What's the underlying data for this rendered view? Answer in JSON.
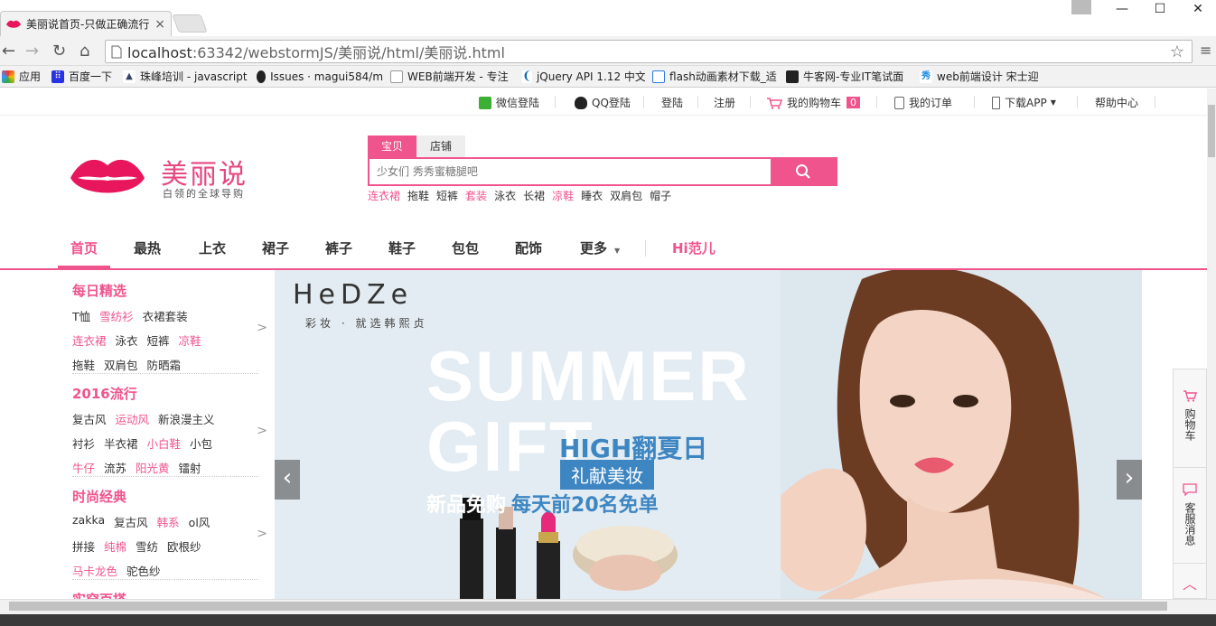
{
  "browser": {
    "tab_title": "美丽说首页-只做正确流行",
    "url_host": "localhost",
    "url_rest": ":63342/webstormJS/美丽说/html/美丽说.html",
    "bookmarks": [
      {
        "label": "应用",
        "icon": "apps-grid-icon",
        "color": "#e84"
      },
      {
        "label": "百度一下",
        "icon": "baidu-paw-icon",
        "color": "#2932e1"
      },
      {
        "label": "珠峰培训 - javascript",
        "icon": "mountain-icon",
        "color": "#346"
      },
      {
        "label": "Issues · magui584/m",
        "icon": "github-icon",
        "color": "#222"
      },
      {
        "label": "WEB前端开发 - 专注",
        "icon": "page-icon",
        "color": "#999"
      },
      {
        "label": "jQuery API 1.12 中文",
        "icon": "jquery-icon",
        "color": "#0769ad"
      },
      {
        "label": "flash动画素材下载_适",
        "icon": "page-icon",
        "color": "#2a7ae2"
      },
      {
        "label": "牛客网-专业IT笔试面",
        "icon": "nowcoder-icon",
        "color": "#222"
      },
      {
        "label": "web前端设计 宋士迎",
        "icon": "xiu-icon",
        "color": "#1a8ce6"
      }
    ]
  },
  "topbar": {
    "wechat_login": "微信登陆",
    "qq_login": "QQ登陆",
    "login": "登陆",
    "register": "注册",
    "cart": "我的购物车",
    "cart_count": "0",
    "orders": "我的订单",
    "download_app": "下载APP",
    "help": "帮助中心"
  },
  "logo": {
    "title": "美丽说",
    "subtitle": "白领的全球导购"
  },
  "search": {
    "tab_items": "宝贝",
    "tab_shops": "店铺",
    "placeholder": "少女们 秀秀蜜糖腿吧",
    "hot": [
      {
        "label": "连衣裙",
        "pink": true
      },
      {
        "label": "拖鞋",
        "pink": false
      },
      {
        "label": "短裤",
        "pink": false
      },
      {
        "label": "套装",
        "pink": true
      },
      {
        "label": "泳衣",
        "pink": false
      },
      {
        "label": "长裙",
        "pink": false
      },
      {
        "label": "凉鞋",
        "pink": true
      },
      {
        "label": "睡衣",
        "pink": false
      },
      {
        "label": "双肩包",
        "pink": false
      },
      {
        "label": "帽子",
        "pink": false
      }
    ]
  },
  "nav": {
    "home": "首页",
    "hot": "最热",
    "tops": "上衣",
    "skirts": "裙子",
    "pants": "裤子",
    "shoes": "鞋子",
    "bags": "包包",
    "accessories": "配饰",
    "more": "更多",
    "hi": "Hi范儿"
  },
  "categories": [
    {
      "title": "每日精选",
      "rows": [
        [
          {
            "t": "T恤",
            "p": false
          },
          {
            "t": "雪纺衫",
            "p": true
          },
          {
            "t": "衣裙套装",
            "p": false
          }
        ],
        [
          {
            "t": "连衣裙",
            "p": true
          },
          {
            "t": "泳衣",
            "p": false
          },
          {
            "t": "短裤",
            "p": false
          },
          {
            "t": "凉鞋",
            "p": true
          }
        ],
        [
          {
            "t": "拖鞋",
            "p": false
          },
          {
            "t": "双肩包",
            "p": false
          },
          {
            "t": "防晒霜",
            "p": false
          }
        ]
      ]
    },
    {
      "title": "2016流行",
      "rows": [
        [
          {
            "t": "复古风",
            "p": false
          },
          {
            "t": "运动风",
            "p": true
          },
          {
            "t": "新浪漫主义",
            "p": false
          }
        ],
        [
          {
            "t": "衬衫",
            "p": false
          },
          {
            "t": "半衣裙",
            "p": false
          },
          {
            "t": "小白鞋",
            "p": true
          },
          {
            "t": "小包",
            "p": false
          }
        ],
        [
          {
            "t": "牛仔",
            "p": true
          },
          {
            "t": "流苏",
            "p": false
          },
          {
            "t": "阳光黄",
            "p": true
          },
          {
            "t": "镭射",
            "p": false
          }
        ]
      ]
    },
    {
      "title": "时尚经典",
      "rows": [
        [
          {
            "t": "zakka",
            "p": false
          },
          {
            "t": "复古风",
            "p": false
          },
          {
            "t": "韩系",
            "p": true
          },
          {
            "t": "ol风",
            "p": false
          }
        ],
        [
          {
            "t": "拼接",
            "p": false
          },
          {
            "t": "纯棉",
            "p": true
          },
          {
            "t": "雪纺",
            "p": false
          },
          {
            "t": "欧根纱",
            "p": false
          }
        ],
        [
          {
            "t": "马卡龙色",
            "p": true
          },
          {
            "t": "驼色纱",
            "p": false
          }
        ]
      ]
    },
    {
      "title": "实穿百搭",
      "rows": []
    }
  ],
  "banner": {
    "brand": "HeDZe",
    "brand_sub": "彩妆 · 就选韩熙贞",
    "summer": "SUMMER",
    "gift": "GIFT",
    "high": "HIGH翻夏日",
    "tag": "礼献美妆",
    "promo": "新品免购",
    "promo_pink": "每天前20名免单"
  },
  "rightpanel": {
    "cart": "购物车",
    "service": "客服消息"
  },
  "colors": {
    "brand_pink": "#f0548c",
    "lips": "#e8175d"
  }
}
